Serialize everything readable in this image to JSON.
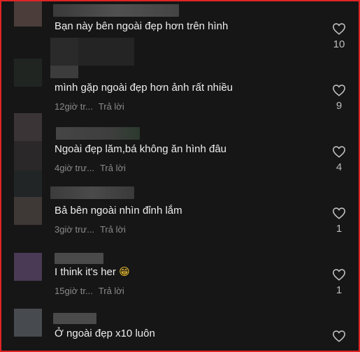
{
  "comments": [
    {
      "text": "Bạn này bên ngoài đẹp hơn trên hình",
      "time": "",
      "reply": "",
      "likes": "10"
    },
    {
      "text": "mình gặp ngoài đẹp hơn ảnh rất nhiều",
      "time": "12giờ tr...",
      "reply": "Trả lời",
      "likes": "9"
    },
    {
      "text": "Ngoài đẹp lăm,bá không ăn hình đâu",
      "time": "4giờ trư...",
      "reply": "Trả lời",
      "likes": "4"
    },
    {
      "text": "Bả bên ngoài nhìn đỉnh lắm",
      "time": "3giờ trư...",
      "reply": "Trả lời",
      "likes": "1"
    },
    {
      "text": "I think it's her",
      "emoji": "😁",
      "time": "15giờ tr...",
      "reply": "Trả lời",
      "likes": "1"
    },
    {
      "text": "Ở ngoài đẹp x10 luôn",
      "time": "",
      "reply": "",
      "likes": ""
    }
  ],
  "colors": {
    "background": "#161616",
    "border": "#e02424",
    "text": "#eeeeee",
    "meta": "#8a8a8a"
  },
  "icons": {
    "like": "heart-outline-icon"
  }
}
